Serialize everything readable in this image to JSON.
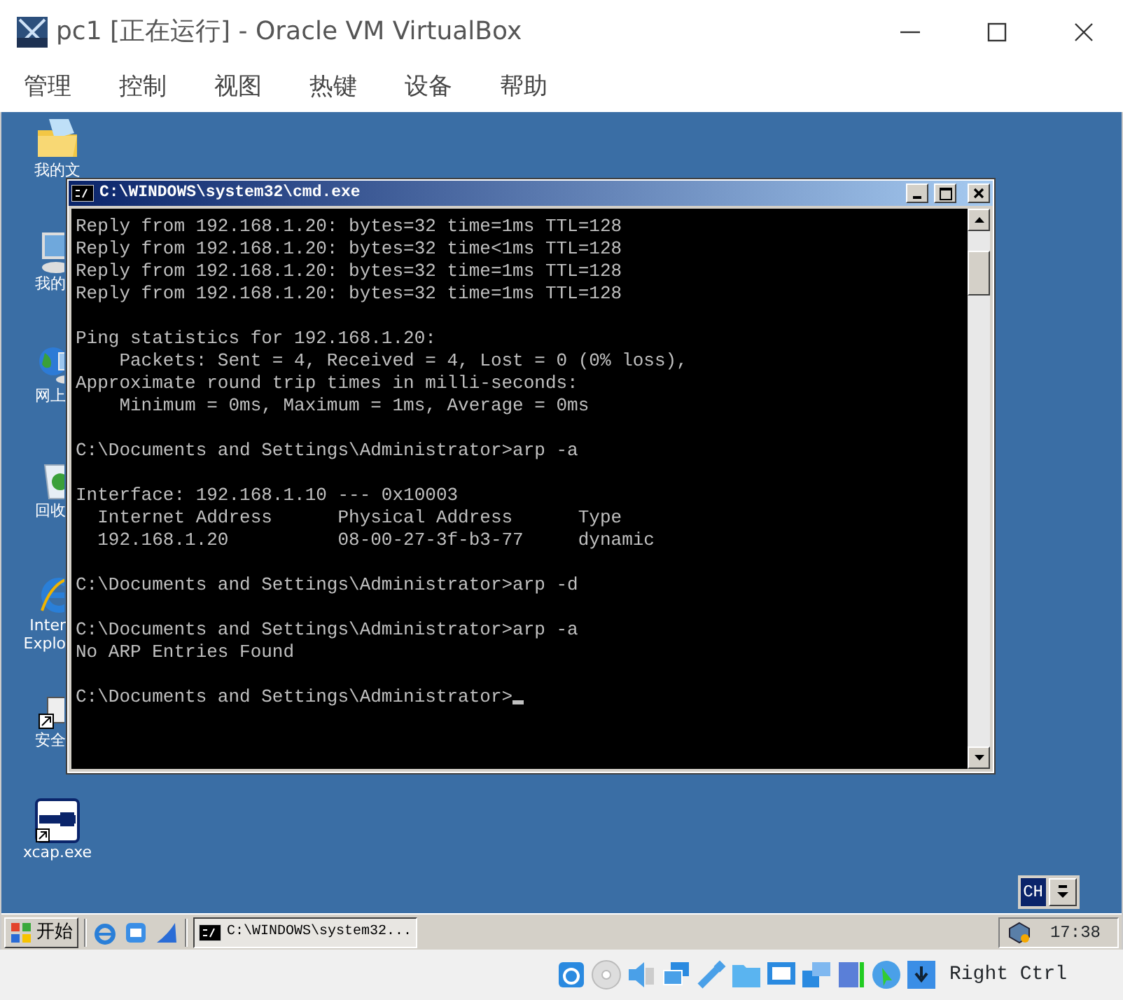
{
  "window": {
    "title": "pc1 [正在运行] - Oracle VM VirtualBox"
  },
  "menu": [
    "管理",
    "控制",
    "视图",
    "热键",
    "设备",
    "帮助"
  ],
  "desktop_icons": [
    {
      "label": "我的文"
    },
    {
      "label": "我的"
    },
    {
      "label": "网上"
    },
    {
      "label": "回收"
    },
    {
      "label": "Inter Explo"
    },
    {
      "label": "安全"
    },
    {
      "label": "xcap.exe"
    }
  ],
  "console": {
    "title": "C:\\WINDOWS\\system32\\cmd.exe",
    "blocks": [
      [
        "Reply from 192.168.1.20: bytes=32 time=1ms TTL=128",
        "Reply from 192.168.1.20: bytes=32 time<1ms TTL=128",
        "Reply from 192.168.1.20: bytes=32 time=1ms TTL=128",
        "Reply from 192.168.1.20: bytes=32 time=1ms TTL=128"
      ],
      [
        "Ping statistics for 192.168.1.20:",
        "    Packets: Sent = 4, Received = 4, Lost = 0 (0% loss),",
        "Approximate round trip times in milli-seconds:",
        "    Minimum = 0ms, Maximum = 1ms, Average = 0ms"
      ],
      [
        "C:\\Documents and Settings\\Administrator>arp -a"
      ],
      [
        "Interface: 192.168.1.10 --- 0x10003",
        "  Internet Address      Physical Address      Type",
        "  192.168.1.20          08-00-27-3f-b3-77     dynamic"
      ],
      [
        "C:\\Documents and Settings\\Administrator>arp -d"
      ],
      [
        "C:\\Documents and Settings\\Administrator>arp -a",
        "No ARP Entries Found"
      ],
      [
        "C:\\Documents and Settings\\Administrator>"
      ]
    ]
  },
  "language_bar": {
    "label": "CH"
  },
  "taskbar": {
    "start": "开始",
    "tasks": [
      {
        "label": "C:\\WINDOWS\\system32...",
        "selected": true
      }
    ],
    "clock": "17:38"
  },
  "status_bar": {
    "host_key": "Right Ctrl"
  }
}
